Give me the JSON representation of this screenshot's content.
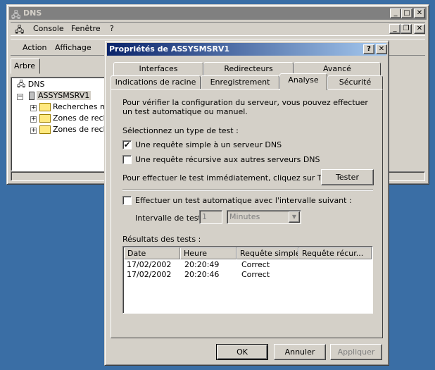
{
  "mmc": {
    "title": "DNS",
    "menu": {
      "console": "Console",
      "window": "Fenêtre",
      "help": "?"
    },
    "toolbar": {
      "action": "Action",
      "view": "Affichage"
    },
    "tree_tab": "Arbre",
    "tree": {
      "root": "DNS",
      "server": "ASSYSMSRV1",
      "items": [
        "Recherches mise",
        "Zones de recher",
        "Zones de recher"
      ]
    }
  },
  "dialog": {
    "title": "Propriétés de ASSYSMSRV1",
    "title_help": "?",
    "title_close": "✕",
    "tabs_row1": [
      "Interfaces",
      "Redirecteurs",
      "Avancé"
    ],
    "tabs_row2": [
      "Indications de racine",
      "Enregistrement",
      "Analyse",
      "Sécurité"
    ],
    "active_tab": "Analyse",
    "intro": "Pour vérifier la configuration du serveur, vous pouvez effectuer un test automatique ou manuel.",
    "select_label": "Sélectionnez un type de test :",
    "simple_query": {
      "label": "Une requête simple à un serveur DNS",
      "checked": true
    },
    "recursive_query": {
      "label": "Une requête récursive aux autres serveurs DNS",
      "checked": false
    },
    "test_now_label": "Pour effectuer le test immédiatement, cliquez sur Tester.",
    "test_button": "Tester",
    "auto_test": {
      "label": "Effectuer un test automatique avec l'intervalle suivant :",
      "checked": false
    },
    "interval_label": "Intervalle de test :",
    "interval_value": "1",
    "interval_unit": "Minutes",
    "results_label": "Résultats des tests :",
    "results_columns": [
      "Date",
      "Heure",
      "Requête simple",
      "Requête récur..."
    ],
    "results_rows": [
      [
        "17/02/2002",
        "20:20:49",
        "Correct",
        ""
      ],
      [
        "17/02/2002",
        "20:20:46",
        "Correct",
        ""
      ]
    ],
    "buttons": {
      "ok": "OK",
      "cancel": "Annuler",
      "apply": "Appliquer"
    }
  }
}
